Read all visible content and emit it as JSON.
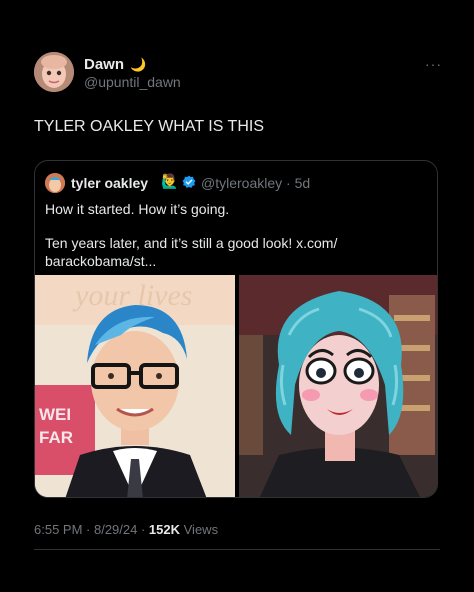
{
  "post": {
    "author_name": "Dawn",
    "author_emoji": "🌙",
    "author_handle": "@upuntil_dawn",
    "more_label": "···",
    "text": "TYLER OAKLEY WHAT IS THIS",
    "time": "6:55 PM",
    "date": "8/29/24",
    "separator": " · ",
    "views_count": "152K",
    "views_label": "Views"
  },
  "quote": {
    "author_name": "tyler oakley",
    "author_emoji": "🙋‍♂️",
    "verified": true,
    "author_handle": "@tyleroakley",
    "age": "5d",
    "line1": "How it started. How it’s going.",
    "line2": "Ten years later, and it’s still a good look! x.com/",
    "line3": "barackobama/st...",
    "media": [
      {
        "description": "man with blue hair and glasses"
      },
      {
        "description": "drag makeup with blue yarn wig"
      }
    ]
  },
  "colors": {
    "background": "#000000",
    "text": "#e7e9ea",
    "muted": "#71767b",
    "verified": "#1d9bf0",
    "border": "#2f3336"
  }
}
